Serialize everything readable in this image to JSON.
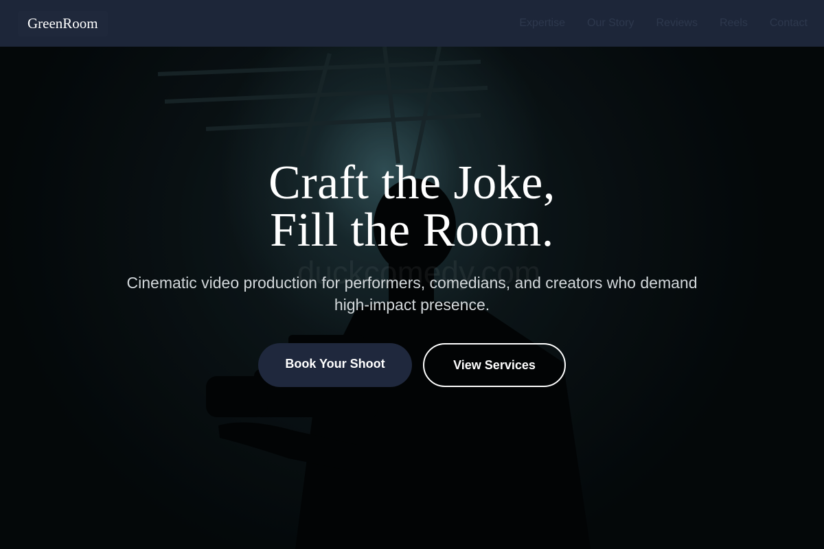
{
  "nav": {
    "logo": "GreenRoom",
    "links": [
      "Expertise",
      "Our Story",
      "Reviews",
      "Reels",
      "Contact"
    ]
  },
  "hero": {
    "headline_line1": "Craft the Joke,",
    "headline_line2": "Fill the Room.",
    "subtitle": "Cinematic video production for performers, comedians, and creators who demand high-impact presence.",
    "primary_cta": "Book Your Shoot",
    "secondary_cta": "View Services",
    "background_image": "silhouette of a videographer holding a camera in a dark studio with a spotlight behind",
    "watermark": "duckcomedy.com"
  },
  "colors": {
    "nav_background": "#1d2639",
    "nav_link": "#2d384d",
    "primary_button": "#1f283d",
    "hero_background": "#050a0c",
    "text": "#ffffff"
  }
}
